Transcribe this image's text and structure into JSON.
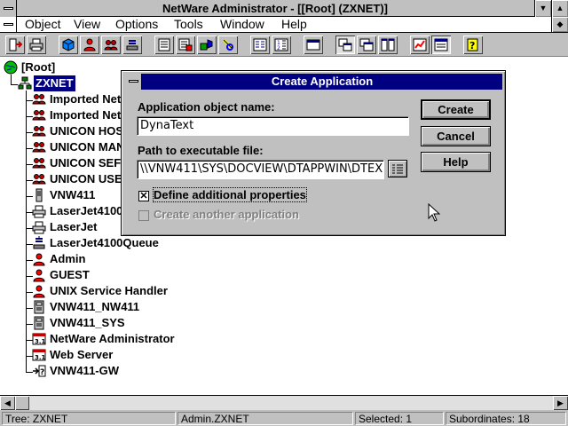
{
  "window": {
    "title": "NetWare Administrator - [[Root] (ZXNET)]"
  },
  "menu": [
    "Object",
    "View",
    "Options",
    "Tools",
    "Window",
    "Help"
  ],
  "toolbar_icons": [
    "exit-icon",
    "print-icon",
    "cube-icon",
    "user-icon",
    "group-icon",
    "queue-icon",
    "list-icon",
    "list-filter-icon",
    "partition-icon",
    "search-icon",
    "browse-icon",
    "sort-icon",
    "window-icon",
    "tile-icon",
    "cascade-icon",
    "arrange-icon",
    "chart-icon",
    "browser-icon",
    "help-icon"
  ],
  "tree": {
    "root": "[Root]",
    "org": "ZXNET",
    "items": [
      {
        "label": "Imported Net",
        "icon": "group-icon"
      },
      {
        "label": "Imported Net",
        "icon": "group-icon"
      },
      {
        "label": "UNICON HOS",
        "icon": "group-icon"
      },
      {
        "label": "UNICON MAN",
        "icon": "group-icon"
      },
      {
        "label": "UNICON SEF",
        "icon": "group-icon"
      },
      {
        "label": "UNICON USE",
        "icon": "group-icon"
      },
      {
        "label": "VNW411",
        "icon": "server-icon"
      },
      {
        "label": "LaserJet4100",
        "icon": "printer-icon"
      },
      {
        "label": "LaserJet",
        "icon": "printer-icon"
      },
      {
        "label": "LaserJet4100Queue",
        "icon": "queue-icon"
      },
      {
        "label": "Admin",
        "icon": "user-icon"
      },
      {
        "label": "GUEST",
        "icon": "user-icon"
      },
      {
        "label": "UNIX Service Handler",
        "icon": "user-icon"
      },
      {
        "label": "VNW411_NW411",
        "icon": "volume-icon"
      },
      {
        "label": "VNW411_SYS",
        "icon": "volume-icon"
      },
      {
        "label": "NetWare Administrator",
        "icon": "application-icon"
      },
      {
        "label": "Web Server",
        "icon": "application-icon"
      },
      {
        "label": "VNW411-GW",
        "icon": "gateway-icon"
      }
    ]
  },
  "dialog": {
    "title": "Create Application",
    "name_label": "Application object name:",
    "name_value": "DynaText",
    "path_label": "Path to executable file:",
    "path_value": "\\\\VNW411\\SYS\\DOCVIEW\\DTAPPWIN\\DTEX",
    "define_label": "Define additional properties",
    "define_checked": "✕",
    "another_label": "Create another application",
    "buttons": {
      "create": "Create",
      "cancel": "Cancel",
      "help": "Help"
    }
  },
  "status": {
    "tree": "Tree: ZXNET",
    "context": "Admin.ZXNET",
    "selected": "Selected: 1",
    "subordinates": "Subordinates: 18"
  },
  "colors": {
    "dialog_title": "#000080",
    "selection": "#000080",
    "face": "#c0c0c0"
  }
}
